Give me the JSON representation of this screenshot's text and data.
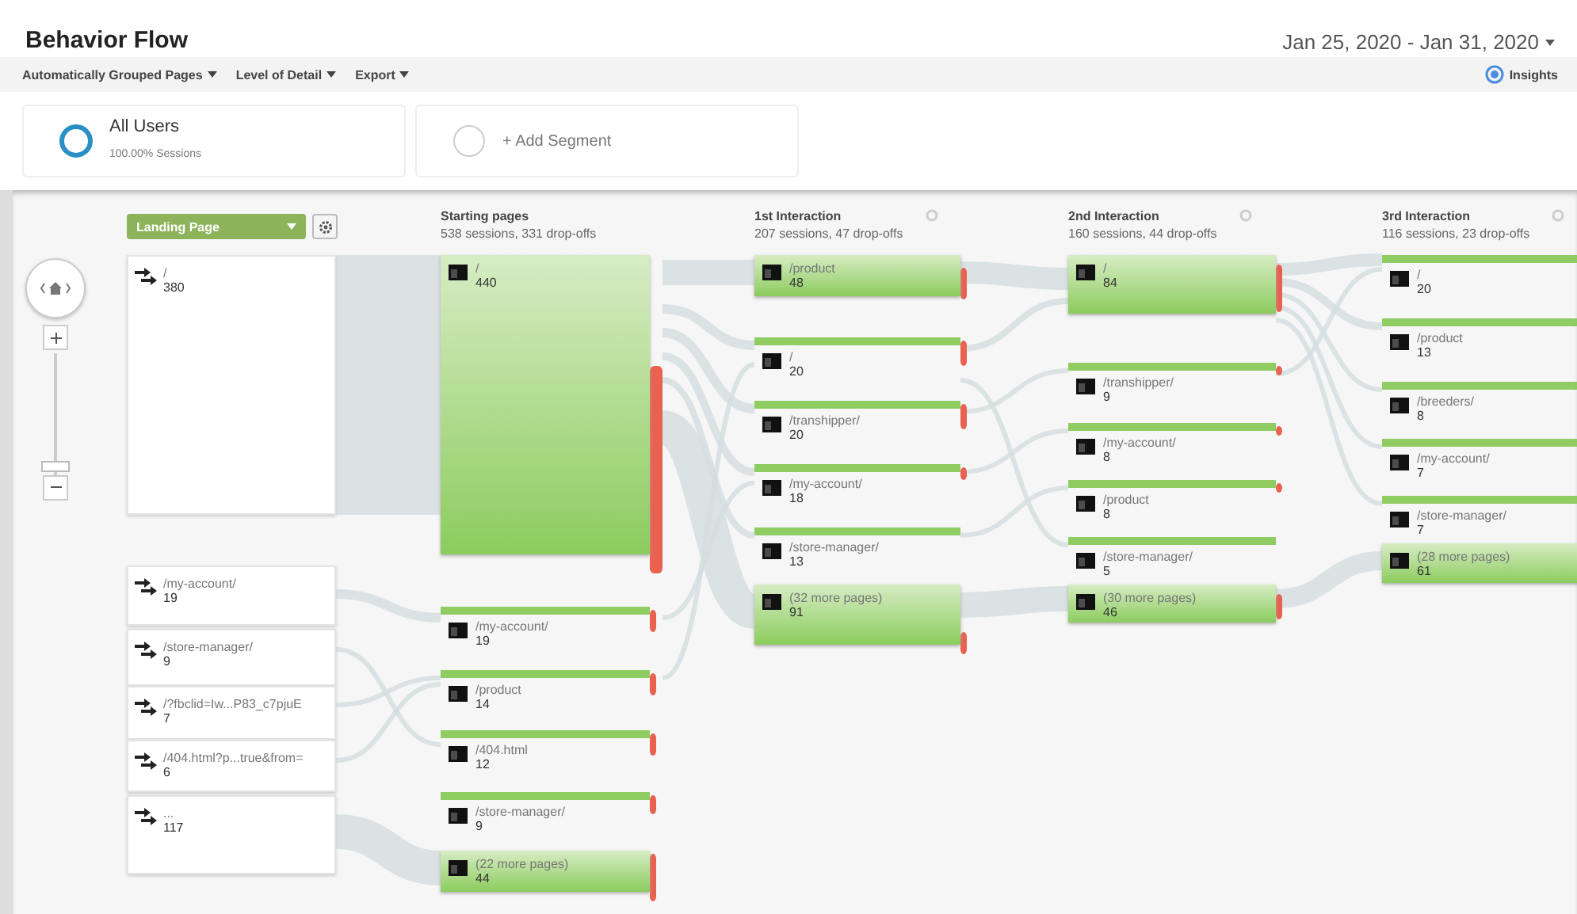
{
  "title": "Behavior Flow",
  "date_range": "Jan 25, 2020 - Jan 31, 2020",
  "toolbar": [
    {
      "label": "Automatically Grouped Pages"
    },
    {
      "label": "Level of Detail"
    },
    {
      "label": "Export"
    }
  ],
  "insights": "Insights",
  "segments": [
    {
      "kind": "segment",
      "name": "All Users",
      "detail": "100.00% Sessions"
    },
    {
      "kind": "add",
      "name": "+ Add Segment"
    }
  ],
  "zoom": {
    "level": 0.06
  },
  "landing": {
    "dimension": "Landing Page",
    "nodes": [
      {
        "label": "/",
        "count": "380"
      },
      {
        "label": "/my-account/",
        "count": "19"
      },
      {
        "label": "/store-manager/",
        "count": "9"
      },
      {
        "label": "/?fbclid=Iw...P83_c7pjuE",
        "count": "7"
      },
      {
        "label": "/404.html?p...true&from=",
        "count": "6"
      },
      {
        "label": "...",
        "count": "117"
      }
    ]
  },
  "columns": [
    {
      "kind": "start",
      "title": "Starting pages",
      "summary": "538 sessions, 331 drop-offs",
      "nodes": [
        {
          "label": "/",
          "count": "440",
          "kind": "major"
        },
        {
          "label": "/my-account/",
          "count": "19",
          "kind": "minor"
        },
        {
          "label": "/product",
          "count": "14",
          "kind": "minor"
        },
        {
          "label": "/404.html",
          "count": "12",
          "kind": "minor"
        },
        {
          "label": "/store-manager/",
          "count": "9",
          "kind": "minor"
        },
        {
          "label": "(22 more pages)",
          "count": "44",
          "kind": "major"
        }
      ]
    },
    {
      "kind": "interaction",
      "title": "1st Interaction",
      "summary": "207 sessions, 47 drop-offs",
      "nodes": [
        {
          "label": "/product",
          "count": "48",
          "kind": "major"
        },
        {
          "label": "/",
          "count": "20",
          "kind": "minor"
        },
        {
          "label": "/transhipper/",
          "count": "20",
          "kind": "minor"
        },
        {
          "label": "/my-account/",
          "count": "18",
          "kind": "minor"
        },
        {
          "label": "/store-manager/",
          "count": "13",
          "kind": "minor"
        },
        {
          "label": "(32 more pages)",
          "count": "91",
          "kind": "major"
        }
      ]
    },
    {
      "kind": "interaction",
      "title": "2nd Interaction",
      "summary": "160 sessions, 44 drop-offs",
      "nodes": [
        {
          "label": "/",
          "count": "84",
          "kind": "major"
        },
        {
          "label": "/transhipper/",
          "count": "9",
          "kind": "minor"
        },
        {
          "label": "/my-account/",
          "count": "8",
          "kind": "minor"
        },
        {
          "label": "/product",
          "count": "8",
          "kind": "minor"
        },
        {
          "label": "/store-manager/",
          "count": "5",
          "kind": "minor"
        },
        {
          "label": "(30 more pages)",
          "count": "46",
          "kind": "major"
        }
      ]
    },
    {
      "kind": "interaction",
      "title": "3rd Interaction",
      "summary": "116 sessions, 23 drop-offs",
      "nodes": [
        {
          "label": "/",
          "count": "20",
          "kind": "minor"
        },
        {
          "label": "/product",
          "count": "13",
          "kind": "minor"
        },
        {
          "label": "/breeders/",
          "count": "8",
          "kind": "minor"
        },
        {
          "label": "/my-account/",
          "count": "7",
          "kind": "minor"
        },
        {
          "label": "/store-manager/",
          "count": "7",
          "kind": "minor"
        },
        {
          "label": "(28 more pages)",
          "count": "61",
          "kind": "major"
        }
      ]
    }
  ]
}
